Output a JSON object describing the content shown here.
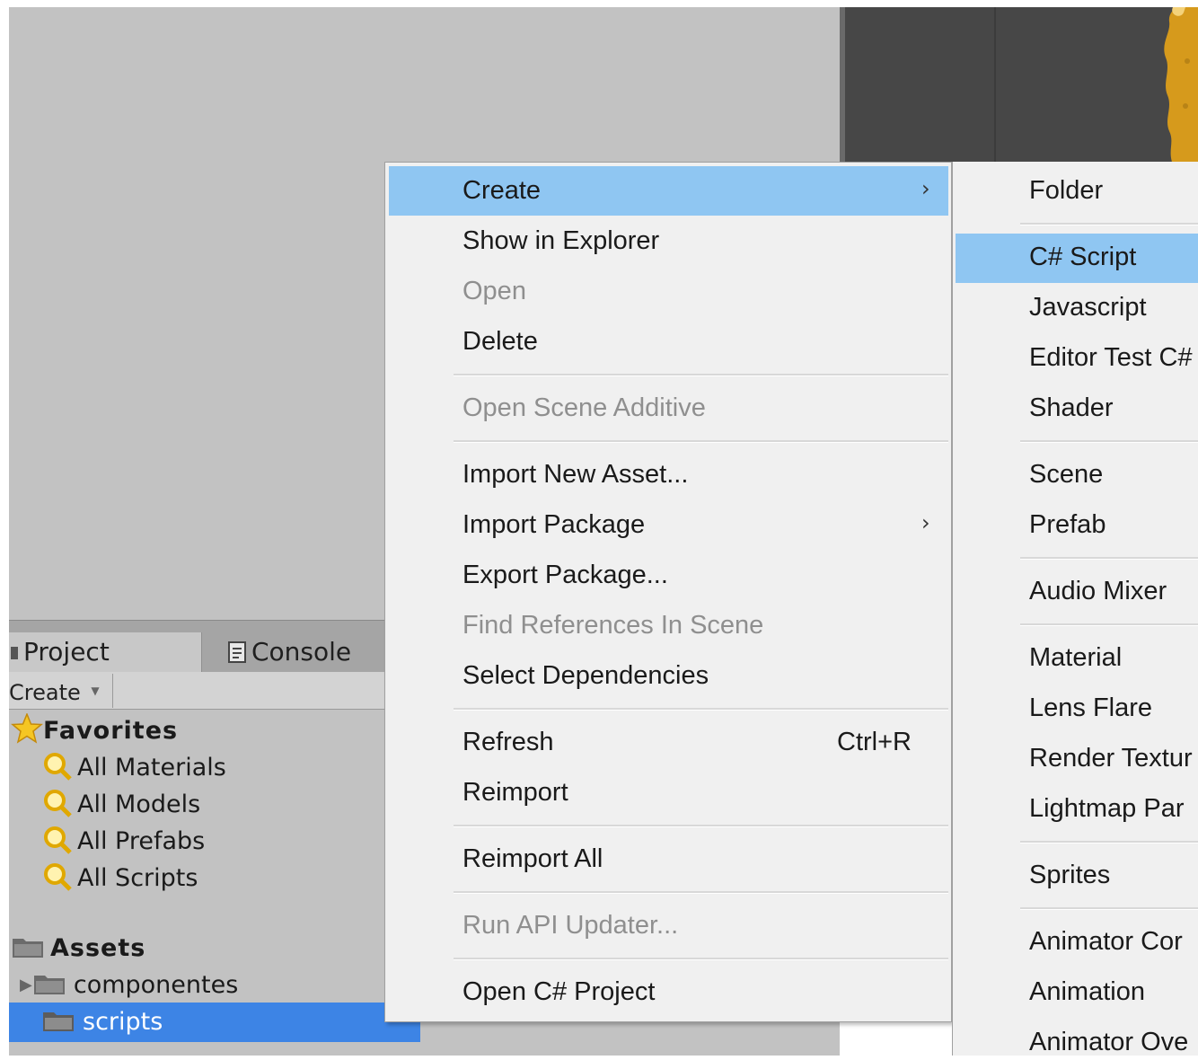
{
  "project_panel": {
    "tabs": [
      {
        "label": "Project",
        "icon": "panel-icon"
      },
      {
        "label": "Console",
        "icon": "console-icon"
      }
    ],
    "toolbar": {
      "create_label": "Create",
      "dropdown_icon": "triangle-down-icon"
    },
    "favorites": {
      "label": "Favorites",
      "icon": "star-icon",
      "items": [
        "All Materials",
        "All Models",
        "All Prefabs",
        "All Scripts"
      ]
    },
    "assets": {
      "label": "Assets",
      "icon": "folder-icon",
      "items": [
        {
          "label": "componentes",
          "expandable": true,
          "selected": false
        },
        {
          "label": "scripts",
          "expandable": false,
          "selected": true
        }
      ]
    }
  },
  "context_menu": {
    "items": [
      {
        "label": "Create",
        "submenu": true,
        "highlighted": true
      },
      {
        "label": "Show in Explorer"
      },
      {
        "label": "Open",
        "disabled": true
      },
      {
        "label": "Delete"
      },
      {
        "label": "Open Scene Additive",
        "disabled": true
      },
      {
        "label": "Import New Asset..."
      },
      {
        "label": "Import Package",
        "submenu": true
      },
      {
        "label": "Export Package..."
      },
      {
        "label": "Find References In Scene",
        "disabled": true
      },
      {
        "label": "Select Dependencies"
      },
      {
        "label": "Refresh",
        "shortcut": "Ctrl+R"
      },
      {
        "label": "Reimport"
      },
      {
        "label": "Reimport All"
      },
      {
        "label": "Run API Updater...",
        "disabled": true
      },
      {
        "label": "Open C# Project"
      }
    ],
    "submenu_arrow": "›"
  },
  "create_submenu": {
    "items": [
      {
        "label": "Folder"
      },
      {
        "label": "C# Script",
        "highlighted": true
      },
      {
        "label": "Javascript"
      },
      {
        "label": "Editor Test C#"
      },
      {
        "label": "Shader"
      },
      {
        "label": "Scene"
      },
      {
        "label": "Prefab"
      },
      {
        "label": "Audio Mixer"
      },
      {
        "label": "Material"
      },
      {
        "label": "Lens Flare"
      },
      {
        "label": "Render Textur"
      },
      {
        "label": "Lightmap Par"
      },
      {
        "label": "Sprites"
      },
      {
        "label": "Animator Cor"
      },
      {
        "label": "Animation"
      },
      {
        "label": "Animator Ove"
      }
    ]
  },
  "colors": {
    "highlight": "#8fc6f2",
    "selection": "#3d84e5",
    "menu_bg": "#f0f0f0",
    "disabled_text": "#8f8f8f"
  }
}
